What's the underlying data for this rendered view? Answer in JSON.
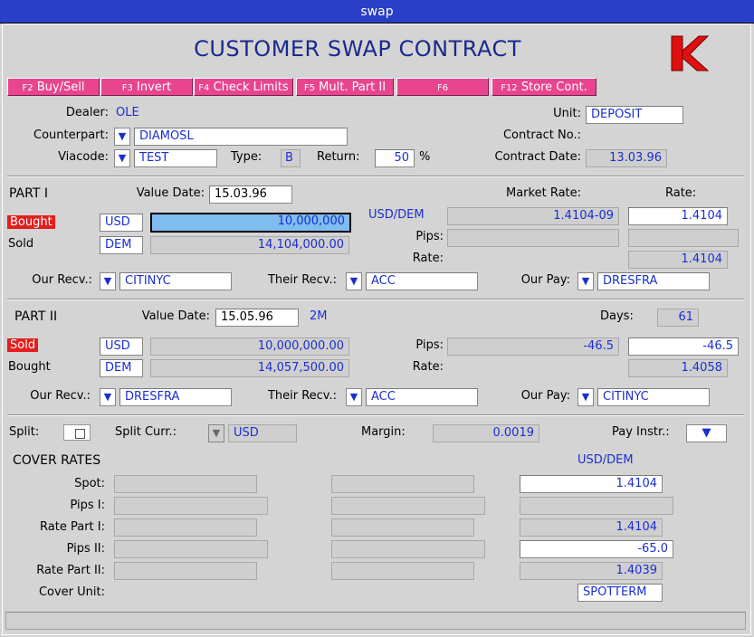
{
  "window": {
    "title": "swap"
  },
  "header": {
    "title": "CUSTOMER  SWAP  CONTRACT"
  },
  "fkeys": [
    {
      "key": "F2",
      "label": "Buy/Sell"
    },
    {
      "key": "F3",
      "label": "Invert"
    },
    {
      "key": "F4",
      "label": "Check Limits"
    },
    {
      "key": "F5",
      "label": "Mult. Part II"
    },
    {
      "key": "F6",
      "label": ""
    },
    {
      "key": "F12",
      "label": "Store Cont."
    }
  ],
  "info": {
    "dealer_label": "Dealer:",
    "dealer": "OLE",
    "counterpart_label": "Counterpart:",
    "counterpart": "DIAMOSL",
    "viacode_label": "Viacode:",
    "viacode": "TEST",
    "type_label": "Type:",
    "type": "B",
    "return_label": "Return:",
    "return_value": "50",
    "percent": "%",
    "unit_label": "Unit:",
    "unit": "DEPOSIT",
    "contract_no_label": "Contract No.:",
    "contract_date_label": "Contract Date:",
    "contract_date": "13.03.96"
  },
  "part1": {
    "title": "PART I",
    "value_date_label": "Value Date:",
    "value_date": "15.03.96",
    "market_rate_label": "Market Rate:",
    "rate_header": "Rate:",
    "bought_label": "Bought",
    "bought_ccy": "USD",
    "bought_amount": "10,000,000",
    "sold_label": "Sold",
    "sold_ccy": "DEM",
    "sold_amount": "14,104,000.00",
    "pair": "USD/DEM",
    "market_rate": "1.4104-09",
    "rate": "1.4104",
    "pips_label": "Pips:",
    "rate_label": "Rate:",
    "rate2": "1.4104",
    "our_recv_label": "Our Recv.:",
    "our_recv": "CITINYC",
    "their_recv_label": "Their Recv.:",
    "their_recv": "ACC",
    "our_pay_label": "Our Pay:",
    "our_pay": "DRESFRA"
  },
  "part2": {
    "title": "PART II",
    "value_date_label": "Value Date:",
    "value_date": "15.05.96",
    "period": "2M",
    "days_label": "Days:",
    "days": "61",
    "sold_label": "Sold",
    "sold_ccy": "USD",
    "sold_amount": "10,000,000.00",
    "bought_label": "Bought",
    "bought_ccy": "DEM",
    "bought_amount": "14,057,500.00",
    "pips_label": "Pips:",
    "pips_market": "-46.5",
    "pips": "-46.5",
    "rate_label": "Rate:",
    "rate": "1.4058",
    "our_recv_label": "Our Recv.:",
    "our_recv": "DRESFRA",
    "their_recv_label": "Their Recv.:",
    "their_recv": "ACC",
    "our_pay_label": "Our Pay:",
    "our_pay": "CITINYC"
  },
  "misc": {
    "split_label": "Split:",
    "split_curr_label": "Split Curr.:",
    "split_curr": "USD",
    "margin_label": "Margin:",
    "margin": "0.0019",
    "pay_instr_label": "Pay Instr.:"
  },
  "cover": {
    "title": "COVER RATES",
    "pair": "USD/DEM",
    "spot_label": "Spot:",
    "spot": "1.4104",
    "pips1_label": "Pips I:",
    "rate1_label": "Rate Part I:",
    "rate1": "1.4104",
    "pips2_label": "Pips II:",
    "pips2": "-65.0",
    "rate2_label": "Rate Part II:",
    "rate2": "1.4039",
    "cover_unit_label": "Cover Unit:",
    "cover_unit": "SPOTTERM"
  },
  "colors": {
    "titlebar": "#2a3fc7",
    "fkey": "#e8458e",
    "value_text": "#1a2fd0",
    "alert": "#e41e1e",
    "logo": "#e01010"
  }
}
